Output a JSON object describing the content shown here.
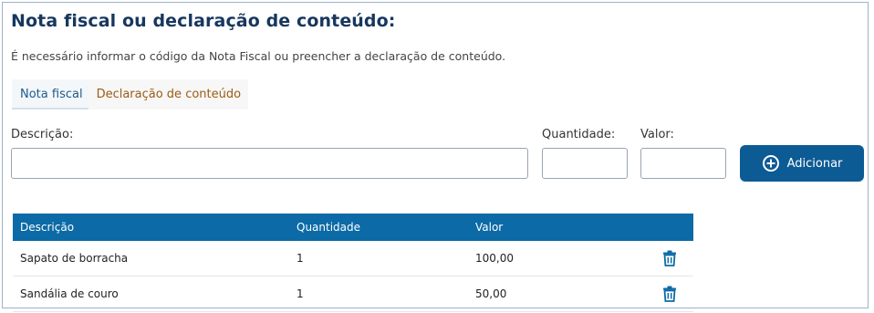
{
  "header": {
    "title": "Nota fiscal ou declaração de conteúdo:",
    "subtitle": "É necessário informar o código da Nota Fiscal ou preencher a declaração de conteúdo."
  },
  "tabs": [
    {
      "label": "Nota fiscal"
    },
    {
      "label": "Declaração de conteúdo"
    }
  ],
  "form": {
    "description_label": "Descrição:",
    "description_value": "",
    "quantity_label": "Quantidade:",
    "quantity_value": "",
    "value_label": "Valor:",
    "value_value": "",
    "add_button_label": "Adicionar"
  },
  "table": {
    "columns": [
      "Descrição",
      "Quantidade",
      "Valor"
    ],
    "rows": [
      {
        "descricao": "Sapato de borracha",
        "quantidade": "1",
        "valor": "100,00"
      },
      {
        "descricao": "Sandália de couro",
        "quantidade": "1",
        "valor": "50,00"
      }
    ]
  },
  "colors": {
    "title": "#17375e",
    "header_bg": "#0c6aa6",
    "button_bg": "#0d5b95",
    "tab_active_text": "#1d5a8a",
    "tab_second_text": "#9c5b14",
    "trash_icon": "#0c6aa6"
  },
  "icons": {
    "add": "plus-circle-icon",
    "delete": "trash-icon"
  }
}
